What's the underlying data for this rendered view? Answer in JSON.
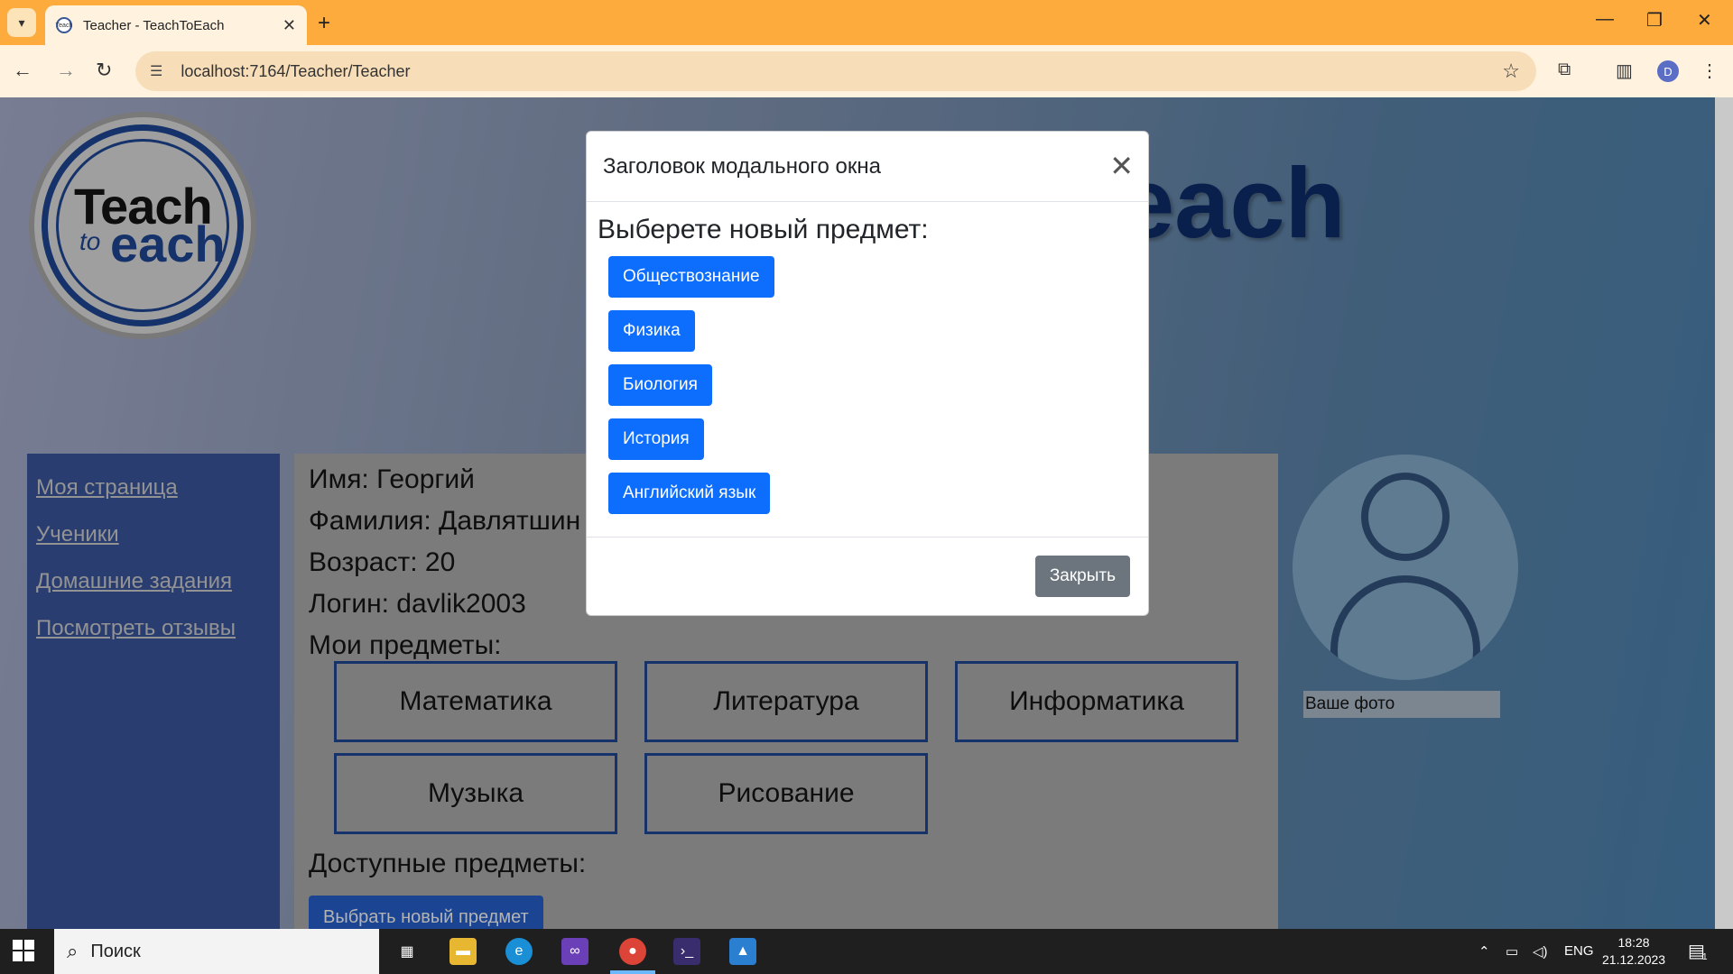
{
  "browser": {
    "tab_title": "Teacher - TeachToEach",
    "favicon_text": "Teach",
    "url": "localhost:7164/Teacher/Teacher",
    "profile_initial": "D"
  },
  "page": {
    "logo": {
      "line1": "Teach",
      "line2": "to",
      "line3": "each"
    },
    "hero_title": "each",
    "sidebar": {
      "items": [
        {
          "label": "Моя страница"
        },
        {
          "label": "Ученики"
        },
        {
          "label": "Домашние задания"
        },
        {
          "label": "Посмотреть отзывы"
        }
      ]
    },
    "profile": {
      "name_line": "Имя: Георгий",
      "surname_line": "Фамилия: Давлятшин",
      "age_line": "Возраст: 20",
      "login_line": "Логин: davlik2003",
      "my_subjects_label": "Мои предметы:",
      "subjects": [
        "Математика",
        "Литература",
        "Информатика",
        "Музыка",
        "Рисование"
      ],
      "available_label": "Доступные предметы:",
      "choose_button": "Выбрать новый предмет"
    },
    "photo_caption": "Ваше фото"
  },
  "modal": {
    "title": "Заголовок модального окна",
    "prompt": "Выберете новый предмет:",
    "options": [
      "Обществознание",
      "Физика",
      "Биология",
      "История",
      "Английский язык"
    ],
    "close_button": "Закрыть"
  },
  "taskbar": {
    "search_placeholder": "Поиск",
    "language": "ENG",
    "time": "18:28",
    "date": "21.12.2023",
    "notification_count": "1"
  },
  "colors": {
    "primary": "#0d6efd",
    "secondary": "#6c757d",
    "sidebar": "#2f4680",
    "chrome": "#fdab3d"
  }
}
